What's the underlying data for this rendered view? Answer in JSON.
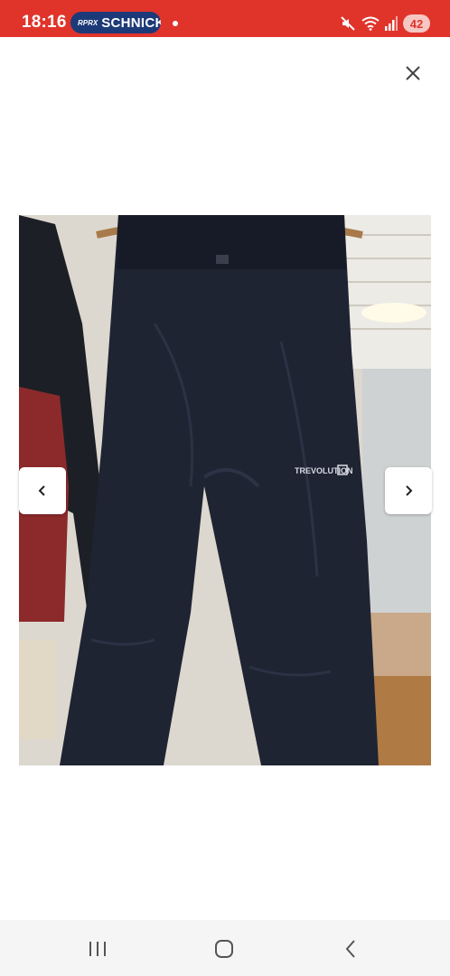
{
  "status_bar": {
    "time": "18:16",
    "app_badge_prefix": "RPRX",
    "app_badge_name": "SCHNICK",
    "battery_level": "42",
    "background_color": "#e0342b"
  },
  "viewer": {
    "close_icon": "close-icon",
    "prev_icon": "chevron-left-icon",
    "next_icon": "chevron-right-icon",
    "photo_label_text": "TREVOLUTION",
    "photo_subject": "dark navy rain trousers on wooden hanger"
  },
  "navigation_bar": {
    "recents_icon": "recents-icon",
    "home_icon": "home-icon",
    "back_icon": "back-icon"
  }
}
